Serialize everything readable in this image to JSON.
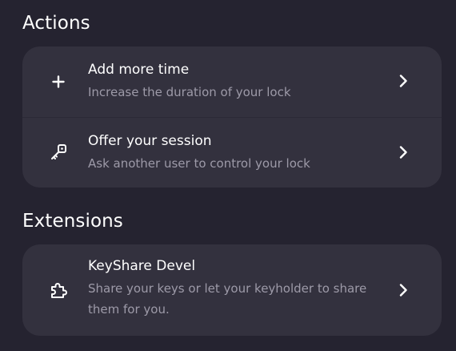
{
  "actions": {
    "heading": "Actions",
    "items": [
      {
        "title": "Add more time",
        "subtitle": "Increase the duration of your lock",
        "icon": "plus-icon"
      },
      {
        "title": "Offer your session",
        "subtitle": "Ask another user to control your lock",
        "icon": "key-icon"
      }
    ]
  },
  "extensions": {
    "heading": "Extensions",
    "items": [
      {
        "title": "KeyShare Devel",
        "subtitle": "Share your keys or let your keyholder to share them for you.",
        "icon": "puzzle-icon"
      }
    ]
  },
  "colors": {
    "background": "#252330",
    "card": "#33313e",
    "text": "#ffffff",
    "muted_text": "#9d9aa8"
  }
}
